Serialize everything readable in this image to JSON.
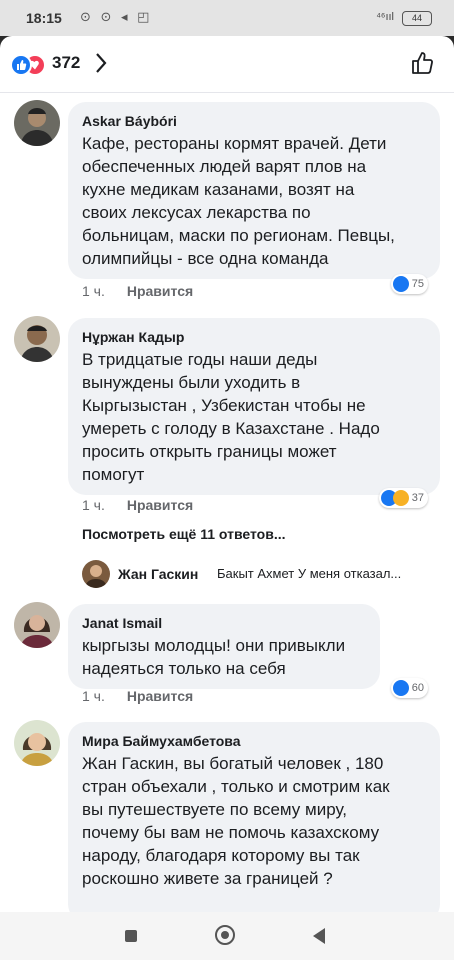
{
  "status_bar": {
    "time": "18:15",
    "icons": "⊙ ⊙ ◂ ◰",
    "signal": "⁴⁶ııl",
    "battery": "44"
  },
  "header": {
    "reaction_count": "372",
    "like_color": "#1877f2",
    "love_color": "#f33e58"
  },
  "comments": [
    {
      "author": "Askar Báybóri",
      "text": "Кафе, рестораны кормят врачей. Дети\nобеспеченных людей варят плов на\nкухне медикам казанами, возят на\nсвоих лексусах лекарства по\nбольницам, маски по регионам. Певцы,\nолимпийцы  - все одна команда",
      "time": "1 ч.",
      "like_label": "Нравится",
      "reactions": "75"
    },
    {
      "author": "Нұржан Кадыр",
      "text": "В тридцатые годы наши деды\nвынуждены были уходить в\nКыргызыстан , Узбекистан чтобы не\nумереть с голоду в Казахстане .  Надо\nпросить открыть границы может\nпомогут",
      "time": "1 ч.",
      "like_label": "Нравится",
      "reactions": "37"
    },
    {
      "author": "Janat Ismail",
      "text": "кыргызы молодцы! они привыкли\nнадеяться только на себя",
      "time": "1 ч.",
      "like_label": "Нравится",
      "reactions": "60"
    },
    {
      "author": "Мира Баймухамбетова",
      "text": "Жан Гаскин, вы богатый человек , 180\nстран объехали , только и смотрим как\nвы путешествуете по всему миру,\nпочему бы вам не помочь казахскому\nнароду, благодаря которому вы так\nроскошно живете за границей ?"
    }
  ],
  "replies": {
    "more_label": "Посмотреть ещё 11 ответов...",
    "preview_author": "Жан Гаскин",
    "preview_text": "Бакыт Ахмет У меня отказал..."
  }
}
